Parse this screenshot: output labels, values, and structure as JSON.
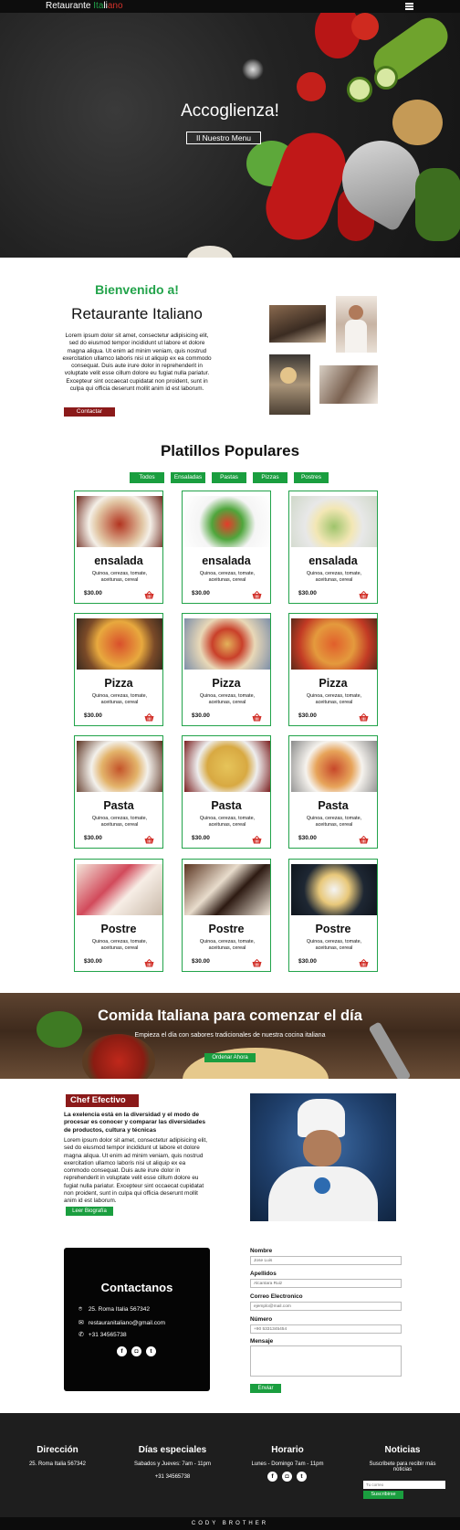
{
  "nav": {
    "brand_part1": "Retaurante ",
    "brand_part2": "Ita",
    "brand_part3": "li",
    "brand_part4": "ano",
    "menu_icon": "hamburger-icon"
  },
  "hero": {
    "title": "Accoglienza!",
    "button": "Il Nuestro Menu"
  },
  "welcome": {
    "subtitle": "Bienvenido a!",
    "title": "Retaurante Italiano",
    "text": "Lorem ipsum dolor sit amet, consectetur adipisicing elit, sed do eiusmod tempor incididunt ut labore et dolore magna aliqua. Ut enim ad minim veniam, quis nostrud exercitation ullamco laboris nisi ut aliquip ex ea commodo consequat. Duis aute irure dolor in reprehenderit in voluptate velit esse cillum dolore eu fugiat nulla pariatur. Excepteur sint occaecat cupidatat non proident, sunt in culpa qui officia deserunt mollit anim id est laborum.",
    "button": "Contactar"
  },
  "popular": {
    "title": "Platillos Populares",
    "filters": [
      "Todos",
      "Ensaladas",
      "Pastas",
      "Pizzas",
      "Postres"
    ],
    "cards": [
      {
        "title": "ensalada",
        "desc": "Quinoa, cerezas, tomate, aceitunas, cereal",
        "price": "$30.00"
      },
      {
        "title": "ensalada",
        "desc": "Quinoa, cerezas, tomate, aceitunas, cereal",
        "price": "$30.00"
      },
      {
        "title": "ensalada",
        "desc": "Quinoa, cerezas, tomate, aceitunas, cereal",
        "price": "$30.00"
      },
      {
        "title": "Pizza",
        "desc": "Quinoa, cerezas, tomate, aceitunas, cereal",
        "price": "$30.00"
      },
      {
        "title": "Pizza",
        "desc": "Quinoa, cerezas, tomate, aceitunas, cereal",
        "price": "$30.00"
      },
      {
        "title": "Pizza",
        "desc": "Quinoa, cerezas, tomate, aceitunas, cereal",
        "price": "$30.00"
      },
      {
        "title": "Pasta",
        "desc": "Quinoa, cerezas, tomate, aceitunas, cereal",
        "price": "$30.00"
      },
      {
        "title": "Pasta",
        "desc": "Quinoa, cerezas, tomate, aceitunas, cereal",
        "price": "$30.00"
      },
      {
        "title": "Pasta",
        "desc": "Quinoa, cerezas, tomate, aceitunas, cereal",
        "price": "$30.00"
      },
      {
        "title": "Postre",
        "desc": "Quinoa, cerezas, tomate, aceitunas, cereal",
        "price": "$30.00"
      },
      {
        "title": "Postre",
        "desc": "Quinoa, cerezas, tomate, aceitunas, cereal",
        "price": "$30.00"
      },
      {
        "title": "Postre",
        "desc": "Quinoa, cerezas, tomate, aceitunas, cereal",
        "price": "$30.00"
      }
    ]
  },
  "banner": {
    "title": "Comida Italiana para comenzar el día",
    "subtitle": "Empieza el día con sabores tradicionales de nuestra cocina italiana",
    "button": "Ordenar Ahora"
  },
  "chef": {
    "badge": "Chef Efectivo",
    "lead": "La exelencia está en la diversidad y el modo de procesar es conocer y comparar las diversidades de productos, cultura y técnicas",
    "text": "Lorem ipsum dolor sit amet, consectetur adipisicing elit, sed do eiusmod tempor incididunt ut labore et dolore magna aliqua. Ut enim ad minim veniam, quis nostrud exercitation ullamco laboris nisi ut aliquip ex ea commodo consequat. Duis aute irure dolor in reprehenderit in voluptate velit esse cillum dolore eu fugiat nulla pariatur. Excepteur sint occaecat cupidatat non proident, sunt in culpa qui officia deserunt mollit anim id est laborum.",
    "button": "Leer Biografía"
  },
  "contact": {
    "title": "Contactanos",
    "address": "25. Roma Italia 567342",
    "email": "restauranitaliano@gmail.com",
    "phone": "+31 34565738",
    "form": {
      "name_label": "Nombre",
      "name_placeholder": "Jose Luis",
      "last_label": "Apellidos",
      "last_placeholder": "Alcantara Ruiz",
      "email_label": "Correo Electronico",
      "email_placeholder": "ejemplo@mail.com",
      "number_label": "Número",
      "number_placeholder": "+90 5331345454",
      "message_label": "Mensaje",
      "submit": "Enviar"
    }
  },
  "footer": {
    "col1_title": "Dirección",
    "col1_text": "25. Roma Italia 567342",
    "col2_title": "Días especiales",
    "col2_text1": "Sabados y Jueves: 7am - 11pm",
    "col2_text2": "+31 34565738",
    "col3_title": "Horario",
    "col3_text": "Lunes - Domingo 7am - 11pm",
    "col4_title": "Noticias",
    "col4_text": "Suscribete para recibir más noticias",
    "newsletter_placeholder": "Tu correo",
    "newsletter_button": "Suscribirse",
    "bottom": "CODY BROTHER"
  },
  "colors": {
    "green": "#1a9e3f",
    "red": "#8b1a1a",
    "dark": "#1e1e1e"
  }
}
